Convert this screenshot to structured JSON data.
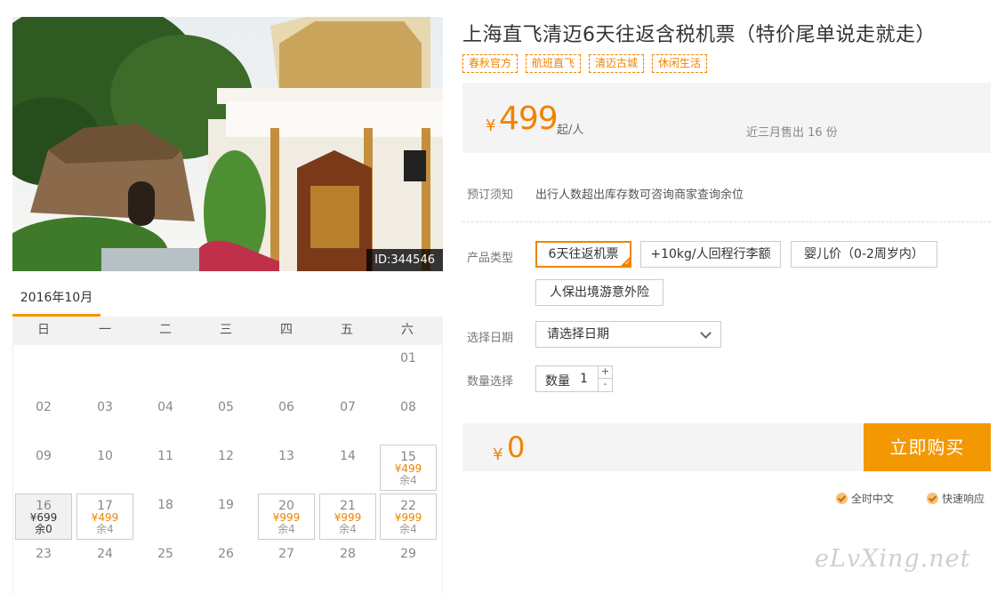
{
  "product": {
    "title": "上海直飞清迈6天往返含税机票（特价尾单说走就走）",
    "tags": [
      "春秋官方",
      "航班直飞",
      "清迈古城",
      "休闲生活"
    ]
  },
  "photo": {
    "id_label": "ID:344546"
  },
  "price": {
    "currency": "¥",
    "value": "499",
    "unit": "起/人",
    "sold_text": "近三月售出 16 份"
  },
  "notice": {
    "label": "预订须知",
    "text": "出行人数超出库存数可咨询商家查询余位"
  },
  "product_type": {
    "label": "产品类型",
    "options": [
      "6天往返机票",
      "+10kg/人回程行李额",
      "婴儿价（0-2周岁内）",
      "人保出境游意外险"
    ],
    "selected": "6天往返机票"
  },
  "date_select": {
    "label": "选择日期",
    "placeholder": "请选择日期"
  },
  "quantity": {
    "label": "数量选择",
    "field_label": "数量",
    "value": "1",
    "plus": "+",
    "minus": "-"
  },
  "total": {
    "currency": "¥",
    "value": "0"
  },
  "buy_button": {
    "label": "立即购买"
  },
  "services": [
    "全时中文",
    "快速响应"
  ],
  "calendar": {
    "month_label": "2016年10月",
    "weekdays": [
      "日",
      "一",
      "二",
      "三",
      "四",
      "五",
      "六"
    ],
    "rows": [
      [
        null,
        null,
        null,
        null,
        null,
        null,
        {
          "day": "01"
        }
      ],
      [
        {
          "day": "02"
        },
        {
          "day": "03"
        },
        {
          "day": "04"
        },
        {
          "day": "05"
        },
        {
          "day": "06"
        },
        {
          "day": "07"
        },
        {
          "day": "08"
        }
      ],
      [
        {
          "day": "09"
        },
        {
          "day": "10"
        },
        {
          "day": "11"
        },
        {
          "day": "12"
        },
        {
          "day": "13"
        },
        {
          "day": "14"
        },
        {
          "day": "15",
          "price": "¥499",
          "stock": "余4"
        }
      ],
      [
        {
          "day": "16",
          "price": "¥699",
          "stock": "余0",
          "state": "sel"
        },
        {
          "day": "17",
          "price": "¥499",
          "stock": "余4"
        },
        {
          "day": "18"
        },
        {
          "day": "19"
        },
        {
          "day": "20",
          "price": "¥999",
          "stock": "余4"
        },
        {
          "day": "21",
          "price": "¥999",
          "stock": "余4"
        },
        {
          "day": "22",
          "price": "¥999",
          "stock": "余4"
        }
      ],
      [
        {
          "day": "23"
        },
        {
          "day": "24"
        },
        {
          "day": "25"
        },
        {
          "day": "26"
        },
        {
          "day": "27"
        },
        {
          "day": "28"
        },
        {
          "day": "29"
        }
      ]
    ]
  },
  "watermark": "eLvXing.net",
  "colors": {
    "accent": "#f08300",
    "button": "#f39800",
    "panel_bg": "#f4f4f4"
  }
}
